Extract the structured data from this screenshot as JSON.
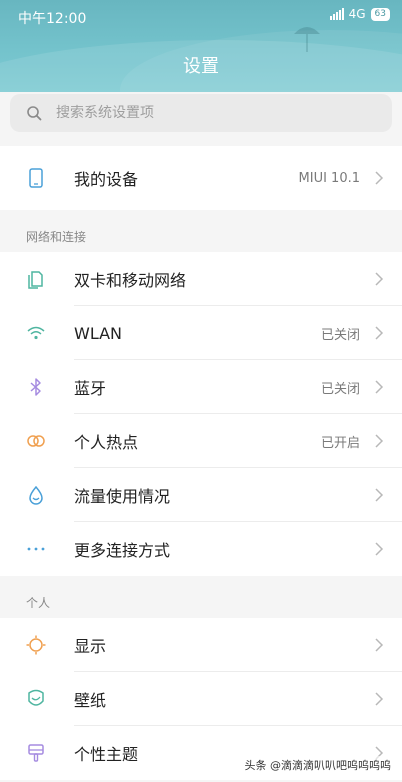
{
  "status_bar": {
    "time": "中午12:00",
    "network": "4G",
    "battery": "63"
  },
  "header": {
    "title": "设置"
  },
  "search": {
    "placeholder": "搜索系统设置项"
  },
  "device": {
    "label": "我的设备",
    "value": "MIUI 10.1"
  },
  "sections": {
    "network": {
      "header": "网络和连接",
      "items": [
        {
          "label": "双卡和移动网络",
          "value": ""
        },
        {
          "label": "WLAN",
          "value": "已关闭"
        },
        {
          "label": "蓝牙",
          "value": "已关闭"
        },
        {
          "label": "个人热点",
          "value": "已开启"
        },
        {
          "label": "流量使用情况",
          "value": ""
        },
        {
          "label": "更多连接方式",
          "value": ""
        }
      ]
    },
    "personal": {
      "header": "个人",
      "items": [
        {
          "label": "显示",
          "value": ""
        },
        {
          "label": "壁纸",
          "value": ""
        },
        {
          "label": "个性主题",
          "value": ""
        }
      ]
    }
  },
  "watermark": "头条 @滴滴滴叭叭吧呜呜呜呜",
  "colors": {
    "header": "#74c3cc",
    "accent_green": "#4fb5a0",
    "accent_orange": "#f0a050",
    "accent_purple": "#a58be0",
    "accent_blue": "#5aa0e0",
    "accent_pink": "#e060a0"
  }
}
